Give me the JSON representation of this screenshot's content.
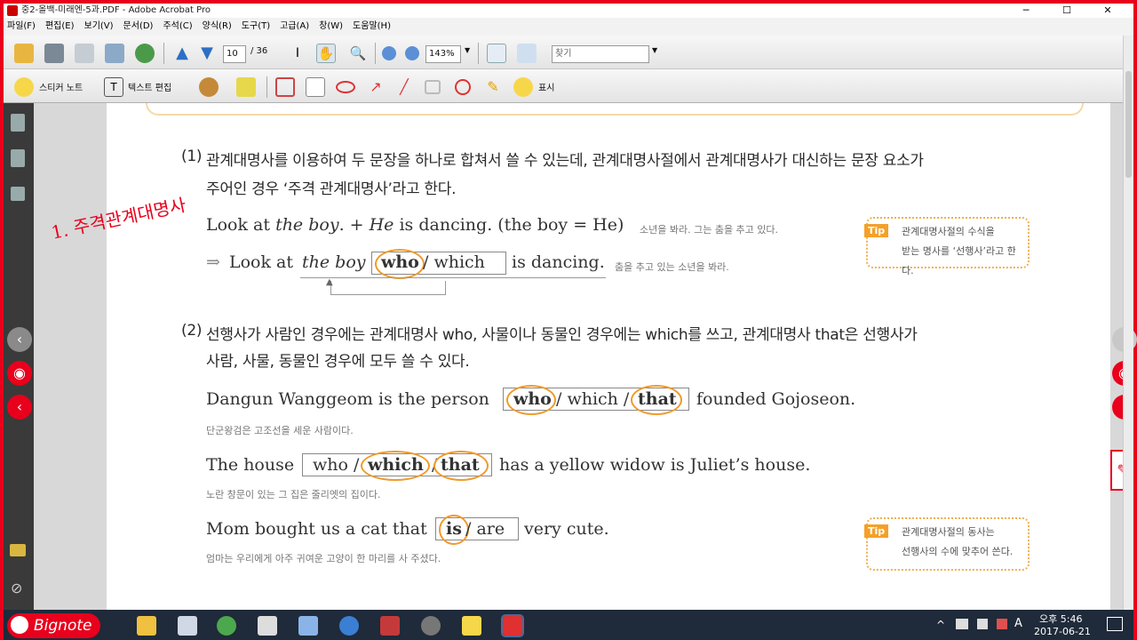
{
  "window": {
    "title": "중2-올백-미래엔-5과.PDF - Adobe Acrobat Pro",
    "minimize": "─",
    "maximize": "☐",
    "close": "✕"
  },
  "menu": [
    "파일(F)",
    "편집(E)",
    "보기(V)",
    "문서(D)",
    "주석(C)",
    "양식(R)",
    "도구(T)",
    "고급(A)",
    "창(W)",
    "도움말(H)"
  ],
  "toolbar": {
    "page_current": "10",
    "page_total": "/ 36",
    "zoom": "143%",
    "search_placeholder": "찾기"
  },
  "comment_toolbar": {
    "sticky_note": "스티커 노트",
    "text_edit": "텍스트 편집",
    "show": "표시"
  },
  "handwriting": "1. 주격관계대명사",
  "section1": {
    "label": "(1)",
    "line1": "관계대명사를 이용하여 두 문장을 하나로 합쳐서 쓸 수 있는데, 관계대명사절에서 관계대명사가 대신하는 문장 요소가",
    "line2": "주어인 경우 ‘주격 관계대명사’라고 한다.",
    "ex1_a": "Look at ",
    "ex1_b": "the boy",
    ". + ": "",
    "ex1_c": ". + ",
    "ex1_d": "He",
    "ex1_e": " is dancing. (the boy = He)",
    "ex1_kor": "소년을 봐라. 그는 춤을 추고 있다.",
    "arrow": "⇒",
    "ex2_a": "Look at ",
    "ex2_b": "the boy",
    "ex2_who": "who",
    "ex2_which": "/ which",
    "ex2_c": "is dancing.",
    "ex2_kor": "춤을 추고 있는 소년을 봐라."
  },
  "tip1": {
    "label": "Tip",
    "line1": "관계대명사절의 수식을",
    "line2": "받는 명사를 ‘선행사’라고 한다."
  },
  "section2": {
    "label": "(2)",
    "line1": "선행사가 사람인 경우에는 관계대명사 who, 사물이나 동물인 경우에는 which를 쓰고, 관계대명사 that은 선행사가",
    "line2": "사람, 사물, 동물인 경우에 모두 쓸 수 있다.",
    "e1_a": "Dangun Wanggeom is the person",
    "e1_who": "who",
    "e1_which": "/ which /",
    "e1_that": "that",
    "e1_b": "founded Gojoseon.",
    "e1_kor": "단군왕검은 고조선을 세운 사람이다.",
    "e2_a": "The house",
    "e2_who": "who /",
    "e2_which": "which",
    "e2_slash": "/",
    "e2_that": "that",
    "e2_b": "has a yellow widow is Juliet’s house.",
    "e2_kor": "노란 창문이 있는 그 집은 줄리엣의 집이다.",
    "e3_a": "Mom bought us a cat that",
    "e3_is": "is",
    "e3_are": "/ are",
    "e3_b": "very cute.",
    "e3_kor": "엄마는 우리에게 아주 귀여운 고양이 한 마리를 사 주셨다."
  },
  "tip2": {
    "label": "Tip",
    "line1": "관계대명사절의 동사는",
    "line2": "선행사의 수에 맞추어 쓴다."
  },
  "taskbar": {
    "time": "오후 5:46",
    "date": "2017-06-21",
    "bignote": "Bignote",
    "lang": "A"
  },
  "colors": {
    "accent": "#e8001c",
    "highlight": "#f09a2a"
  }
}
